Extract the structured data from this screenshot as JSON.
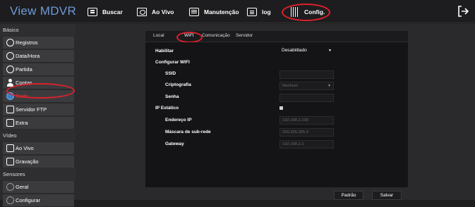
{
  "app": {
    "title": "View MDVR"
  },
  "topnav": {
    "items": [
      {
        "label": "Buscar",
        "icon": "grid-icon"
      },
      {
        "label": "Ao Vivo",
        "icon": "monitor-icon"
      },
      {
        "label": "Manutenção",
        "icon": "maintenance-icon"
      },
      {
        "label": "log",
        "icon": "list-icon"
      },
      {
        "label": "Config.",
        "icon": "sliders-icon"
      }
    ],
    "exit_icon": "exit-icon"
  },
  "sidebar": {
    "groups": [
      {
        "title": "Básico",
        "items": [
          "Registros",
          "Data/Hora",
          "Partida",
          "Contas",
          "Rede",
          "Servidor FTP",
          "Extra"
        ]
      },
      {
        "title": "Vídeo",
        "items": [
          "Ao Vivo",
          "Gravação"
        ]
      },
      {
        "title": "Sensores",
        "items": [
          "Geral",
          "Configurar"
        ]
      }
    ],
    "active": "Rede"
  },
  "tabs": {
    "items": [
      "Local",
      "WIFI",
      "Comunicação",
      "Servidor"
    ],
    "active": "WIFI"
  },
  "form": {
    "habilitar": {
      "label": "Habilitar",
      "value": "Desabilitado"
    },
    "configurar_wifi": {
      "label": "Configurar WIFI"
    },
    "ssid": {
      "label": "SSID",
      "value": ""
    },
    "criptografia": {
      "label": "Criptografia",
      "value": "Nenhum"
    },
    "senha": {
      "label": "Senha",
      "value": ""
    },
    "ip_estatico": {
      "label": "IP Estático",
      "checked": true
    },
    "endereco_ip": {
      "label": "Endereço IP",
      "value": "192.168.2.100"
    },
    "mascara": {
      "label": "Máscara de sub-rede",
      "value": "255.255.255.0"
    },
    "gateway": {
      "label": "Gateway",
      "value": "192.168.2.1"
    }
  },
  "buttons": {
    "padrao": "Padrão",
    "salvar": "Salvar"
  },
  "colors": {
    "accent": "#6e9bd6",
    "highlight_ring": "#e0202a",
    "active_item": "#d23b3b"
  }
}
